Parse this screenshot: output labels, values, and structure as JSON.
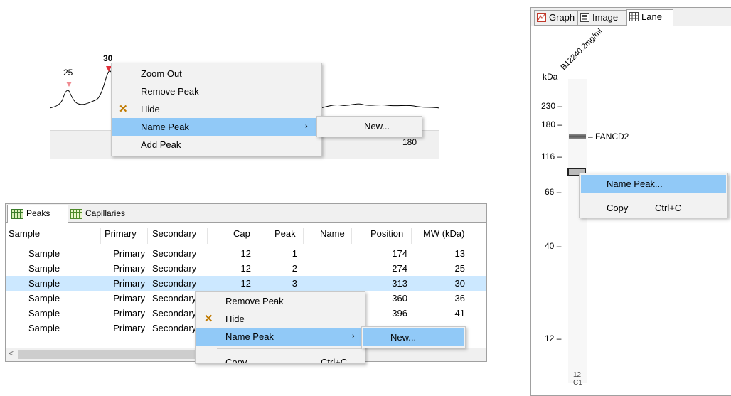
{
  "graph": {
    "peak_left_label": "25",
    "peak_right_label": "30",
    "axis_tick": "180",
    "context_menu": {
      "zoom_out": "Zoom Out",
      "remove_peak": "Remove Peak",
      "hide": "Hide",
      "name_peak": "Name Peak",
      "add_peak": "Add Peak"
    },
    "submenu": {
      "new": "New..."
    }
  },
  "table": {
    "tabs": [
      {
        "label": "Peaks",
        "icon": "grid-icon"
      },
      {
        "label": "Capillaries",
        "icon": "grid-icon"
      }
    ],
    "columns": [
      "Sample",
      "Primary",
      "Secondary",
      "Cap",
      "Peak",
      "Name",
      "Position",
      "MW (kDa)"
    ],
    "rows": [
      {
        "sample": "Sample",
        "primary": "Primary",
        "secondary": "Secondary",
        "cap": "12",
        "peak": "1",
        "name": "",
        "position": "174",
        "mw": "13"
      },
      {
        "sample": "Sample",
        "primary": "Primary",
        "secondary": "Secondary",
        "cap": "12",
        "peak": "2",
        "name": "",
        "position": "274",
        "mw": "25"
      },
      {
        "sample": "Sample",
        "primary": "Primary",
        "secondary": "Secondary",
        "cap": "12",
        "peak": "3",
        "name": "",
        "position": "313",
        "mw": "30"
      },
      {
        "sample": "Sample",
        "primary": "Primary",
        "secondary": "Secondary",
        "cap": "",
        "peak": "",
        "name": "",
        "position": "360",
        "mw": "36"
      },
      {
        "sample": "Sample",
        "primary": "Primary",
        "secondary": "Secondary",
        "cap": "",
        "peak": "",
        "name": "",
        "position": "396",
        "mw": "41"
      },
      {
        "sample": "Sample",
        "primary": "Primary",
        "secondary": "Secondary",
        "cap": "",
        "peak": "",
        "name": "",
        "position": "",
        "mw": ""
      }
    ],
    "context_menu": {
      "remove_peak": "Remove Peak",
      "hide": "Hide",
      "name_peak": "Name Peak",
      "copy": "Copy",
      "copy_shortcut": "Ctrl+C"
    },
    "submenu": {
      "new": "New..."
    }
  },
  "lane_view": {
    "tabs": [
      {
        "label": "Graph",
        "icon": "graph-icon"
      },
      {
        "label": "Image",
        "icon": "image-icon"
      },
      {
        "label": "Lane",
        "icon": "lane-icon"
      }
    ],
    "sample_name": "B12240.2mg/ml",
    "kda_label": "kDa",
    "ticks": [
      "230",
      "180",
      "116",
      "66",
      "40",
      "12"
    ],
    "band_label": "FANCD2",
    "capillary_number": "12",
    "capillary_id": "C1",
    "context_menu": {
      "name_peak": "Name Peak...",
      "copy": "Copy",
      "copy_shortcut": "Ctrl+C"
    }
  },
  "colors": {
    "selection": "#91c9f7",
    "row_selected": "#cce8ff",
    "check_mark": "#c07a00",
    "peak_marker": "#e0303a"
  }
}
